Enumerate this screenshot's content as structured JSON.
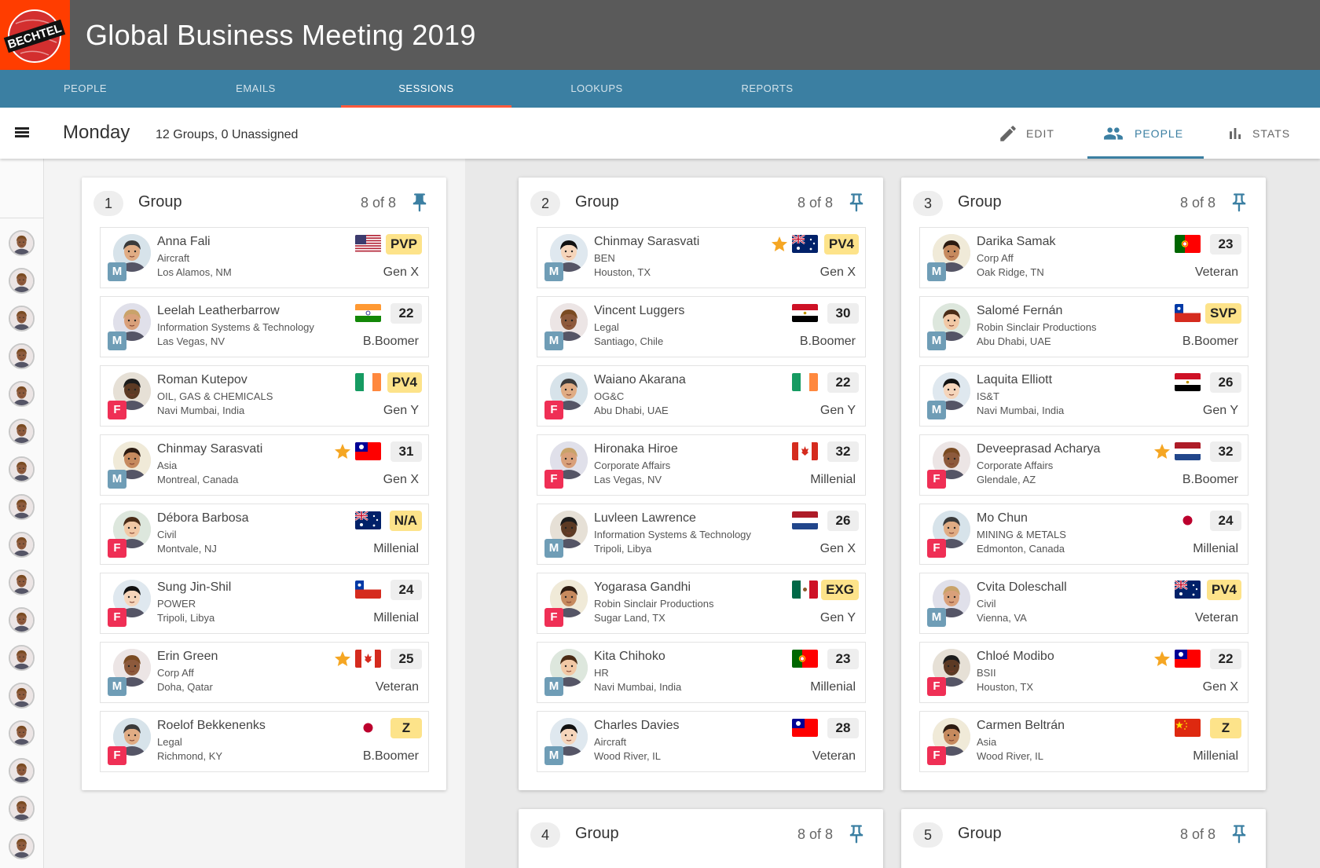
{
  "app": {
    "title": "Global Business Meeting 2019",
    "logo_text": "BECHTEL"
  },
  "tabs": [
    {
      "label": "PEOPLE"
    },
    {
      "label": "EMAILS"
    },
    {
      "label": "SESSIONS",
      "active": true
    },
    {
      "label": "LOOKUPS"
    },
    {
      "label": "REPORTS"
    }
  ],
  "toolbar": {
    "day": "Monday",
    "summary": "12 Groups, 0 Unassigned",
    "edit_label": "EDIT",
    "people_label": "PEOPLE",
    "stats_label": "STATS"
  },
  "colors": {
    "header": "#5a5a5a",
    "tabbar": "#3b7fa2",
    "accent": "#ff5a3c",
    "male": "#6f9db6",
    "female": "#ef2f55",
    "badge_highlight": "#fde38a"
  },
  "groups": [
    {
      "number": "1",
      "title": "Group",
      "count": "8 of 8",
      "pinned": true,
      "people": [
        {
          "name": "Anna Fali",
          "dept": "Aircraft",
          "location": "Los Alamos, NM",
          "gen": "M",
          "generation": "Gen X",
          "code": "PVP",
          "flag": "us",
          "star": false
        },
        {
          "name": "Leelah Leatherbarrow",
          "dept": "Information Systems & Technology",
          "location": "Las Vegas, NV",
          "gen": "M",
          "generation": "B.Boomer",
          "code": "22",
          "flag": "in",
          "star": false
        },
        {
          "name": "Roman Kutepov",
          "dept": "OIL, GAS & CHEMICALS",
          "location": "Navi Mumbai, India",
          "gen": "F",
          "generation": "Gen Y",
          "code": "PV4",
          "flag": "ie",
          "star": false
        },
        {
          "name": "Chinmay Sarasvati",
          "dept": "Asia",
          "location": "Montreal, Canada",
          "gen": "M",
          "generation": "Gen X",
          "code": "31",
          "flag": "tw",
          "star": true
        },
        {
          "name": "Débora Barbosa",
          "dept": "Civil",
          "location": "Montvale, NJ",
          "gen": "F",
          "generation": "Millenial",
          "code": "N/A",
          "flag": "au",
          "star": false
        },
        {
          "name": "Sung Jin-Shil",
          "dept": "POWER",
          "location": "Tripoli, Libya",
          "gen": "F",
          "generation": "Millenial",
          "code": "24",
          "flag": "cl",
          "star": false
        },
        {
          "name": "Erin Green",
          "dept": "Corp Aff",
          "location": "Doha, Qatar",
          "gen": "M",
          "generation": "Veteran",
          "code": "25",
          "flag": "ca",
          "star": true
        },
        {
          "name": "Roelof Bekkenenks",
          "dept": "Legal",
          "location": "Richmond, KY",
          "gen": "F",
          "generation": "B.Boomer",
          "code": "Z",
          "flag": "jp",
          "star": false
        }
      ]
    },
    {
      "number": "2",
      "title": "Group",
      "count": "8 of 8",
      "pinned": false,
      "people": [
        {
          "name": "Chinmay Sarasvati",
          "dept": "BEN",
          "location": "Houston, TX",
          "gen": "M",
          "generation": "Gen X",
          "code": "PV4",
          "flag": "au",
          "star": true
        },
        {
          "name": "Vincent Luggers",
          "dept": "Legal",
          "location": "Santiago, Chile",
          "gen": "M",
          "generation": "B.Boomer",
          "code": "30",
          "flag": "eg",
          "star": false
        },
        {
          "name": "Waiano Akarana",
          "dept": "OG&C",
          "location": "Abu Dhabi, UAE",
          "gen": "F",
          "generation": "Gen Y",
          "code": "22",
          "flag": "ie",
          "star": false
        },
        {
          "name": "Hironaka Hiroe",
          "dept": "Corporate Affairs",
          "location": "Las Vegas, NV",
          "gen": "F",
          "generation": "Millenial",
          "code": "32",
          "flag": "ca",
          "star": false
        },
        {
          "name": "Luvleen Lawrence",
          "dept": "Information Systems & Technology",
          "location": "Tripoli, Libya",
          "gen": "M",
          "generation": "Gen X",
          "code": "26",
          "flag": "nl",
          "star": false
        },
        {
          "name": "Yogarasa Gandhi",
          "dept": "Robin Sinclair Productions",
          "location": "Sugar Land, TX",
          "gen": "F",
          "generation": "Gen Y",
          "code": "EXG",
          "flag": "mx",
          "star": false
        },
        {
          "name": "Kita Chihoko",
          "dept": "HR",
          "location": "Navi Mumbai, India",
          "gen": "M",
          "generation": "Millenial",
          "code": "23",
          "flag": "pt",
          "star": false
        },
        {
          "name": "Charles Davies",
          "dept": "Aircraft",
          "location": "Wood River, IL",
          "gen": "M",
          "generation": "Veteran",
          "code": "28",
          "flag": "tw",
          "star": false
        }
      ]
    },
    {
      "number": "3",
      "title": "Group",
      "count": "8 of 8",
      "pinned": false,
      "people": [
        {
          "name": "Darika Samak",
          "dept": "Corp Aff",
          "location": "Oak Ridge, TN",
          "gen": "M",
          "generation": "Veteran",
          "code": "23",
          "flag": "pt",
          "star": false
        },
        {
          "name": "Salomé Fernán",
          "dept": "Robin Sinclair Productions",
          "location": "Abu Dhabi, UAE",
          "gen": "M",
          "generation": "B.Boomer",
          "code": "SVP",
          "flag": "cl",
          "star": false
        },
        {
          "name": "Laquita Elliott",
          "dept": "IS&T",
          "location": "Navi Mumbai, India",
          "gen": "M",
          "generation": "Gen Y",
          "code": "26",
          "flag": "eg",
          "star": false
        },
        {
          "name": "Deveeprasad Acharya",
          "dept": "Corporate Affairs",
          "location": "Glendale, AZ",
          "gen": "F",
          "generation": "B.Boomer",
          "code": "32",
          "flag": "nl",
          "star": true
        },
        {
          "name": "Mo Chun",
          "dept": "MINING & METALS",
          "location": "Edmonton, Canada",
          "gen": "F",
          "generation": "Millenial",
          "code": "24",
          "flag": "jp",
          "star": false
        },
        {
          "name": "Cvita Doleschall",
          "dept": "Civil",
          "location": "Vienna, VA",
          "gen": "M",
          "generation": "Veteran",
          "code": "PV4",
          "flag": "au",
          "star": false
        },
        {
          "name": "Chloé Modibo",
          "dept": "BSII",
          "location": "Houston, TX",
          "gen": "F",
          "generation": "Gen X",
          "code": "22",
          "flag": "tw",
          "star": true
        },
        {
          "name": "Carmen Beltrán",
          "dept": "Asia",
          "location": "Wood River, IL",
          "gen": "F",
          "generation": "Millenial",
          "code": "Z",
          "flag": "cn",
          "star": false
        }
      ]
    },
    {
      "number": "4",
      "title": "Group",
      "count": "8 of 8",
      "pinned": false,
      "people": []
    },
    {
      "number": "5",
      "title": "Group",
      "count": "8 of 8",
      "pinned": false,
      "people": []
    }
  ]
}
